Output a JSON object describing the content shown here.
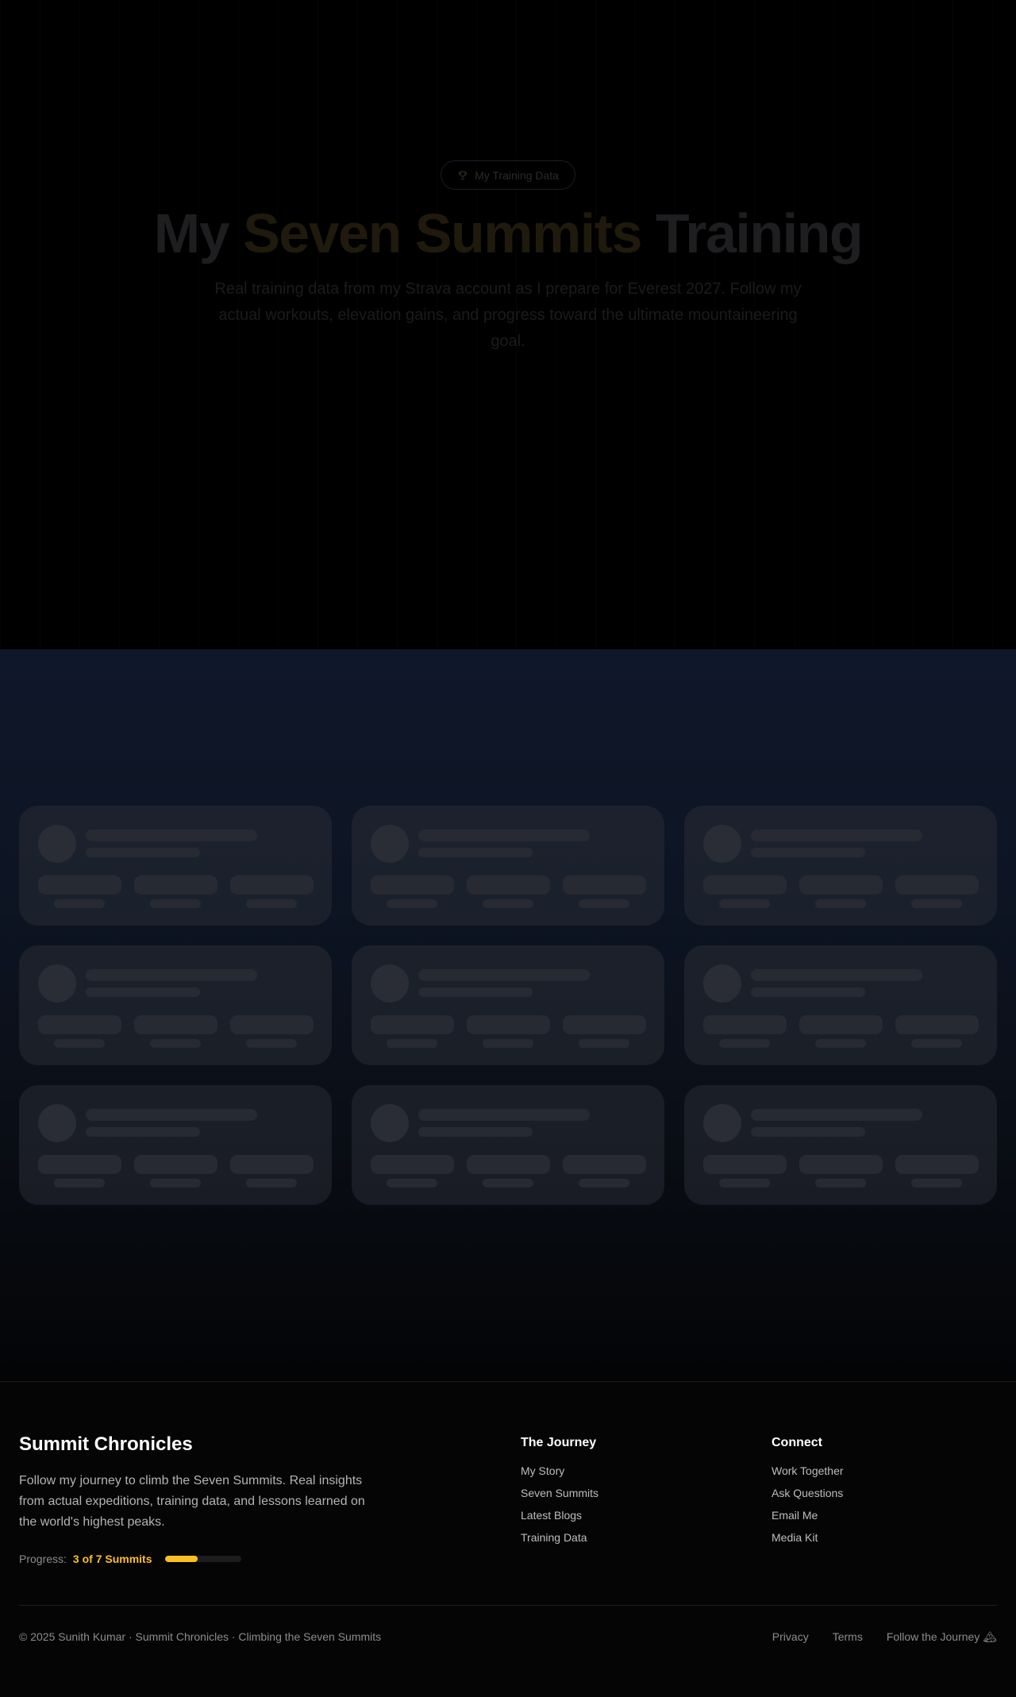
{
  "hero": {
    "badge_label": "My Training Data",
    "badge_icon": "trophy-icon",
    "title_prefix": "My ",
    "title_accent": "Seven Summits",
    "title_suffix": " Training",
    "subtitle": "Real training data from my Strava account as I prepare for Everest 2027. Follow my actual workouts, elevation gains, and progress toward the ultimate mountaineering goal."
  },
  "activities": {
    "state": "loading",
    "placeholder_cards": 9
  },
  "footer": {
    "brand": "Summit Chronicles",
    "description": "Follow my journey to climb the Seven Summits. Real insights from actual expeditions, training data, and lessons learned on the world's highest peaks.",
    "progress_label": "Progress:",
    "progress_value": "3 of 7 Summits",
    "progress_fraction": 0.43,
    "journey_heading": "The Journey",
    "journey_links": [
      "My Story",
      "Seven Summits",
      "Latest Blogs",
      "Training Data"
    ],
    "connect_heading": "Connect",
    "connect_links": [
      "Work Together",
      "Ask Questions",
      "Email Me",
      "Media Kit"
    ],
    "copyright": "© 2025 Sunith Kumar · Summit Chronicles · Climbing the Seven Summits",
    "legal_links": [
      "Privacy",
      "Terms",
      "Follow the Journey 🏔"
    ]
  },
  "colors": {
    "accent": "#fbbf24",
    "background": "#000000",
    "section_bg": "#0f172a"
  }
}
